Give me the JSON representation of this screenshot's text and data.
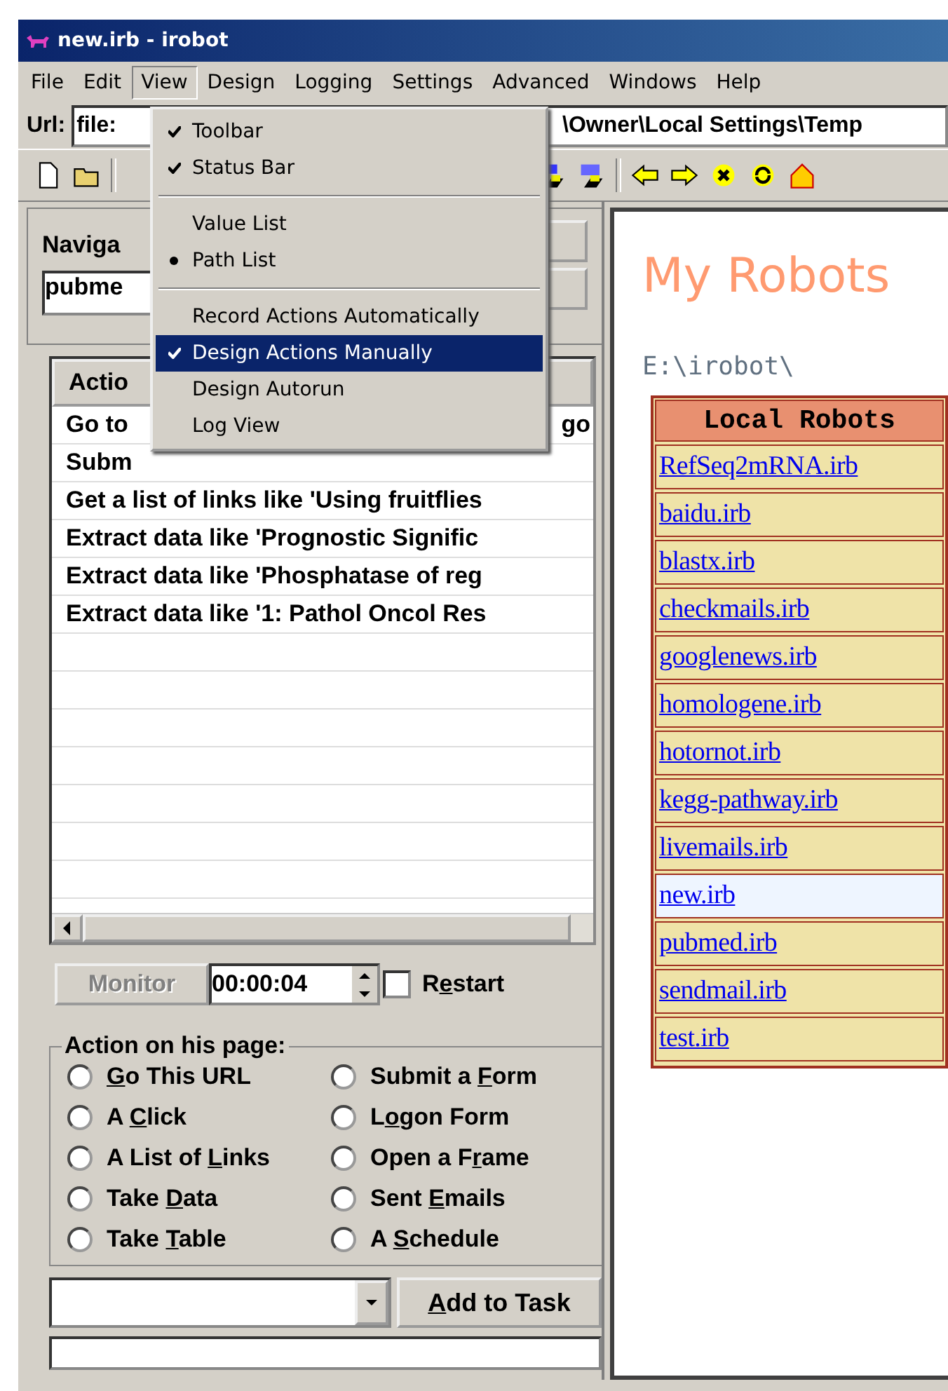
{
  "window": {
    "title": "new.irb - irobot"
  },
  "menu_bar": [
    {
      "label": "File",
      "selected": false
    },
    {
      "label": "Edit",
      "selected": false
    },
    {
      "label": "View",
      "selected": true
    },
    {
      "label": "Design",
      "selected": false
    },
    {
      "label": "Logging",
      "selected": false
    },
    {
      "label": "Settings",
      "selected": false
    },
    {
      "label": "Advanced",
      "selected": false
    },
    {
      "label": "Windows",
      "selected": false
    },
    {
      "label": "Help",
      "selected": false
    }
  ],
  "view_menu": [
    {
      "kind": "check",
      "label": "Toolbar",
      "checked": true,
      "selected": false
    },
    {
      "kind": "check",
      "label": "Status Bar",
      "checked": true,
      "selected": false
    },
    {
      "kind": "separator"
    },
    {
      "kind": "radio",
      "label": "Value List",
      "checked": false,
      "selected": false
    },
    {
      "kind": "radio",
      "label": "Path List",
      "checked": true,
      "selected": false
    },
    {
      "kind": "separator"
    },
    {
      "kind": "check",
      "label": "Record Actions Automatically",
      "checked": false,
      "selected": false
    },
    {
      "kind": "check",
      "label": "Design Actions Manually",
      "checked": true,
      "selected": true
    },
    {
      "kind": "check",
      "label": "Design Autorun",
      "checked": false,
      "selected": false
    },
    {
      "kind": "check",
      "label": "Log View",
      "checked": false,
      "selected": false
    }
  ],
  "url_bar": {
    "label": "Url:",
    "value": "file:",
    "tail": "\\Owner\\Local Settings\\Temp"
  },
  "navigation": {
    "label": "Naviga",
    "value": "pubme"
  },
  "actions_list": {
    "header": "Actio",
    "rows": [
      {
        "text": "Go to",
        "tail": "go"
      },
      {
        "text": "Subm"
      },
      {
        "text": "Get a list of links like 'Using fruitflies"
      },
      {
        "text": "Extract data like 'Prognostic Signific"
      },
      {
        "text": "Extract data like 'Phosphatase of reg"
      },
      {
        "text": "Extract data like '1: Pathol Oncol Res"
      }
    ]
  },
  "monitor": {
    "button": "Monitor",
    "disabled": true,
    "time": "00:00:04",
    "restart": {
      "before": "R",
      "key": "e",
      "after": "start",
      "checked": false
    }
  },
  "action_group": {
    "title": "Action on his page:",
    "options": [
      {
        "key": "G",
        "after": "o This URL",
        "selected": false
      },
      {
        "before": "Submit a ",
        "key": "F",
        "after": "orm",
        "selected": false
      },
      {
        "before": "A ",
        "key": "C",
        "after": "lick",
        "selected": false
      },
      {
        "before": "L",
        "key": "o",
        "after": "gon Form",
        "selected": false
      },
      {
        "before": "A List of ",
        "key": "L",
        "after": "inks",
        "selected": false
      },
      {
        "before": "Open a F",
        "key": "r",
        "after": "ame",
        "selected": false
      },
      {
        "before": "Take ",
        "key": "D",
        "after": "ata",
        "selected": false
      },
      {
        "before": "Sent ",
        "key": "E",
        "after": "mails",
        "selected": false
      },
      {
        "before": "Take ",
        "key": "T",
        "after": "able",
        "selected": false
      },
      {
        "before": "A ",
        "key": "S",
        "after": "chedule",
        "selected": false
      }
    ]
  },
  "add_task": {
    "key": "A",
    "after": "dd to Task"
  },
  "browser": {
    "heading": "My Robots",
    "path": "E:\\irobot\\",
    "table_header": "Local Robots",
    "robots": [
      {
        "name": "RefSeq2mRNA.irb",
        "highlighted": false
      },
      {
        "name": "baidu.irb",
        "highlighted": false
      },
      {
        "name": "blastx.irb",
        "highlighted": false
      },
      {
        "name": "checkmails.irb",
        "highlighted": false
      },
      {
        "name": "googlenews.irb",
        "highlighted": false
      },
      {
        "name": "homologene.irb",
        "highlighted": false
      },
      {
        "name": "hotornot.irb",
        "highlighted": false
      },
      {
        "name": "kegg-pathway.irb",
        "highlighted": false
      },
      {
        "name": "livemails.irb",
        "highlighted": false
      },
      {
        "name": "new.irb",
        "highlighted": true
      },
      {
        "name": "pubmed.irb",
        "highlighted": false
      },
      {
        "name": "sendmail.irb",
        "highlighted": false
      },
      {
        "name": "test.irb",
        "highlighted": false
      }
    ]
  }
}
